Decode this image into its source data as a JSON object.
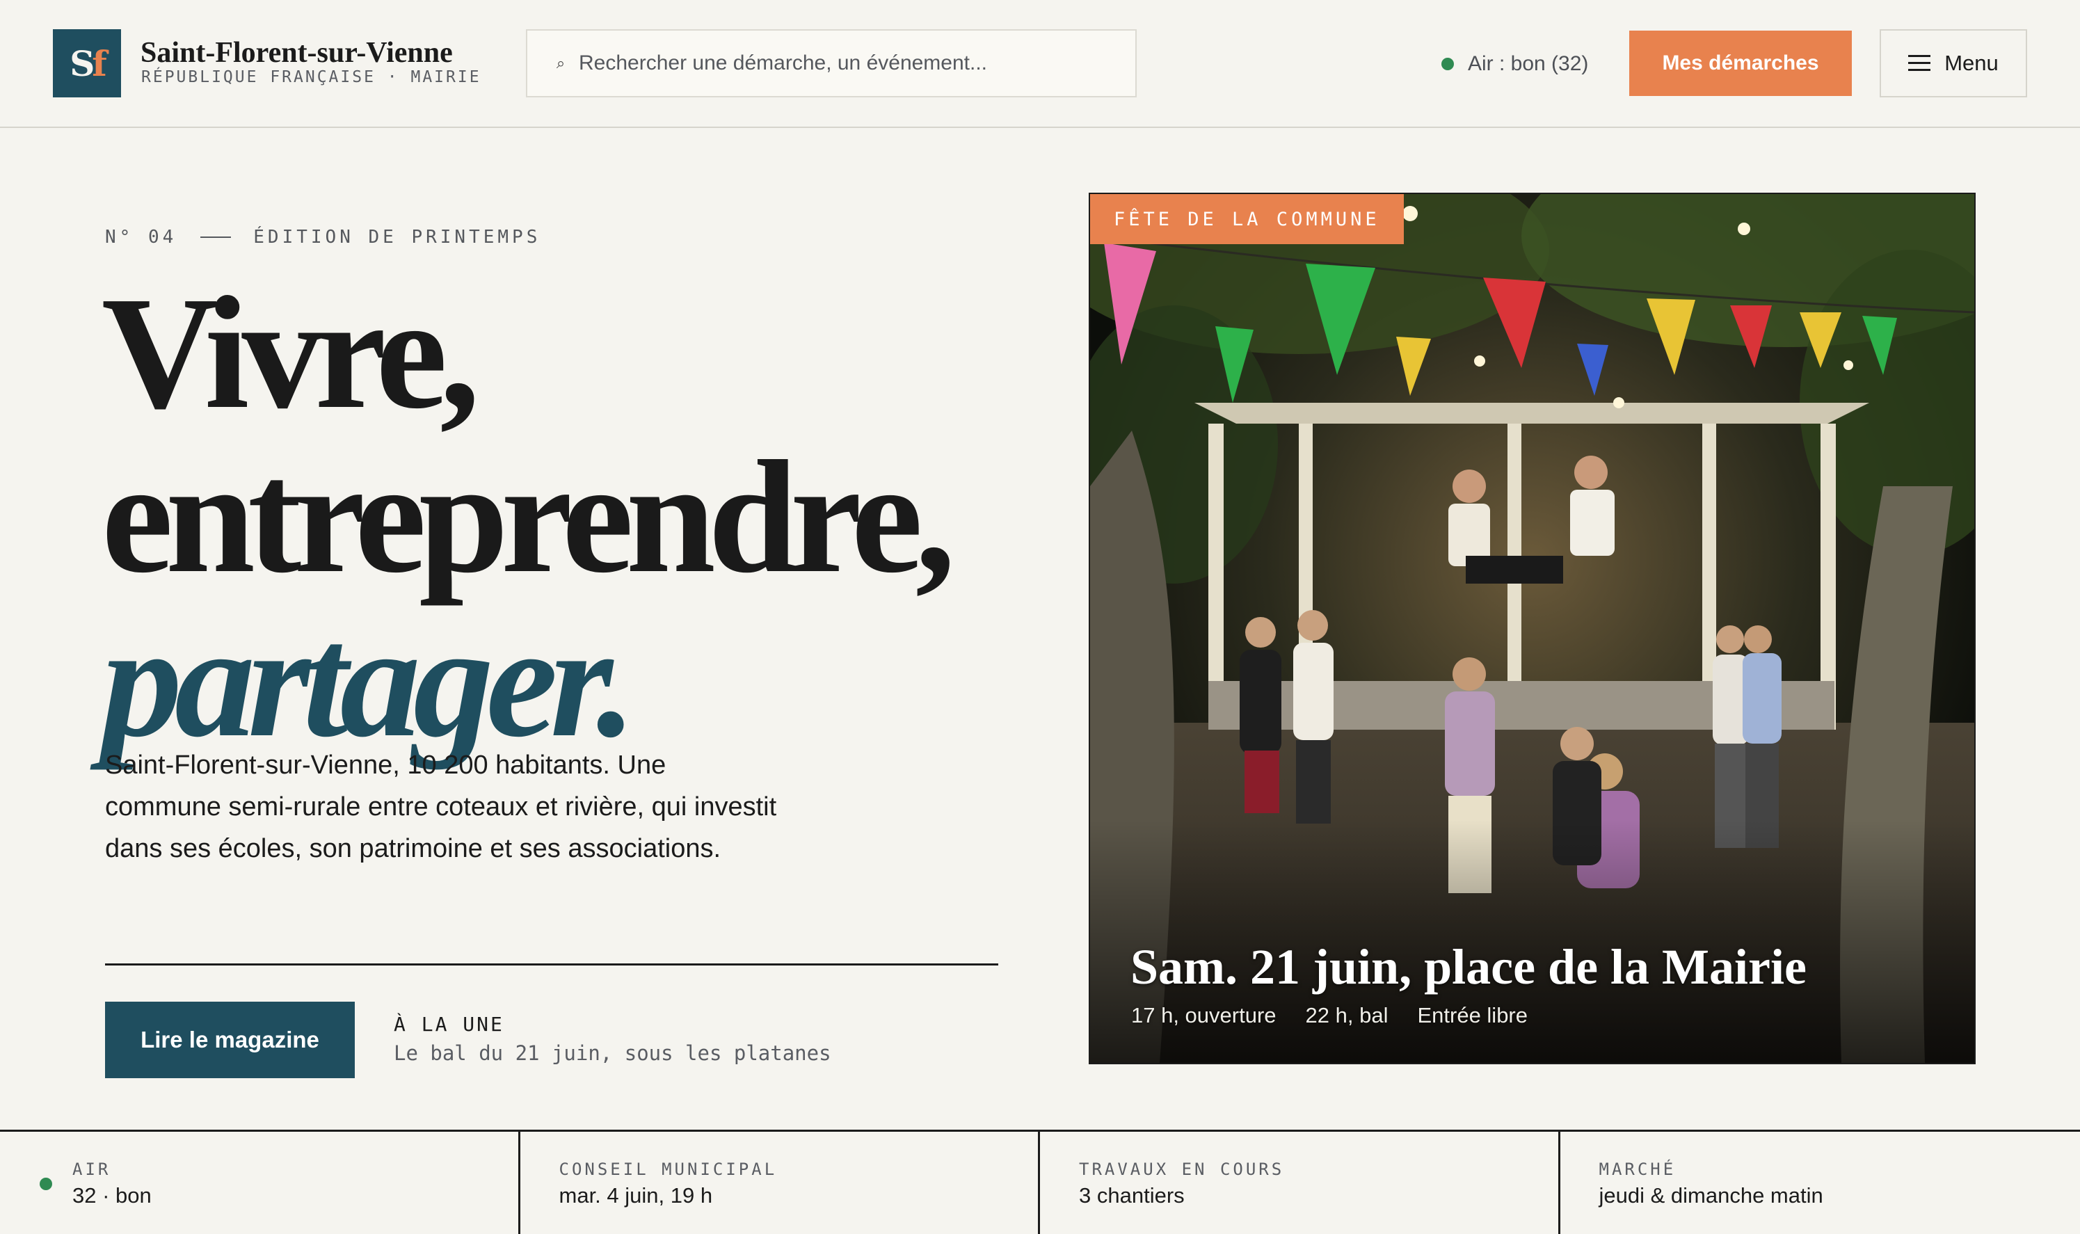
{
  "header": {
    "logo": {
      "s": "S",
      "f": "f"
    },
    "site_name": "Saint-Florent-sur-Vienne",
    "site_sub": "RÉPUBLIQUE FRANÇAISE · MAIRIE",
    "search_placeholder": "Rechercher une démarche, un événement...",
    "air_status": "Air : bon (32)",
    "status_color": "#2f8a52",
    "primary_button": "Mes démarches",
    "menu_button": "Menu"
  },
  "hero": {
    "kicker_number": "N° 04",
    "kicker_edition": "ÉDITION DE PRINTEMPS",
    "headline_line1": "Vivre,",
    "headline_line2": "entreprendre,",
    "headline_line3": "partager.",
    "lede": "Saint-Florent-sur-Vienne, 10 200 habitants. Une commune semi-rurale entre coteaux et rivière, qui investit dans ses écoles, son patrimoine et ses associations.",
    "cta_button": "Lire le magazine",
    "une_label": "À LA UNE",
    "une_text": "Le bal du 21 juin, sous les platanes"
  },
  "feature": {
    "tag": "FÊTE DE LA COMMUNE",
    "title": "Sam. 21 juin, place de la Mairie",
    "meta": [
      "17 h, ouverture",
      "22 h, bal",
      "Entrée libre"
    ]
  },
  "info_strip": [
    {
      "label": "AIR",
      "value": "32 · bon"
    },
    {
      "label": "CONSEIL MUNICIPAL",
      "value": "mar. 4 juin, 19 h"
    },
    {
      "label": "TRAVAUX EN COURS",
      "value": "3 chantiers"
    },
    {
      "label": "MARCHÉ",
      "value": "jeudi & dimanche matin"
    }
  ],
  "colors": {
    "brand": "#1f4e5f",
    "accent": "#e8824e",
    "background": "#f5f4ef",
    "status_good": "#2f8a52"
  },
  "icons": {
    "search": "search-icon",
    "menu": "hamburger-icon",
    "status": "status-dot-icon"
  }
}
